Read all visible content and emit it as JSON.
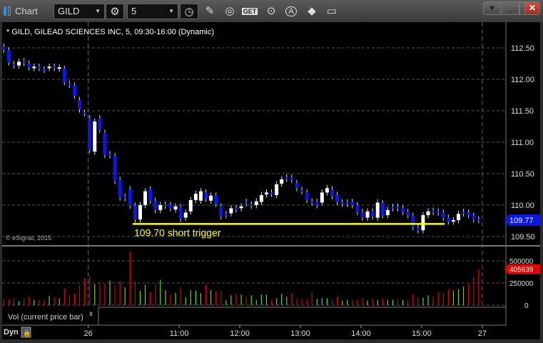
{
  "window": {
    "title": "Chart",
    "symbol": "GILD",
    "interval": "5",
    "tool_icons": [
      "pencil-icon",
      "chart-curve-icon",
      "get-icon",
      "play-icon",
      "alert-a-icon",
      "link-diamond-icon",
      "comment-icon"
    ],
    "get_label": "GET",
    "alert_label": "A"
  },
  "chart_title": "* GILD, GILEAD SCIENCES INC, 5, 09:30-16:00 (Dynamic)",
  "copyright": "© eSignal, 2015",
  "annotation": {
    "label": "109.70 short trigger",
    "price": 109.7,
    "color": "#ffff00"
  },
  "price_axis": {
    "labels": [
      "112.50",
      "112.00",
      "111.50",
      "111.00",
      "110.50",
      "110.00",
      "109.50"
    ],
    "values": [
      112.5,
      112,
      111.5,
      111,
      110.5,
      110,
      109.5
    ],
    "last_price": "109.77",
    "last_color": "#0a18e0"
  },
  "volume_axis": {
    "labels": [
      "500000",
      "250000",
      "0"
    ],
    "values": [
      500000,
      250000,
      0
    ],
    "last_volume": "405639",
    "last_color": "#e00000"
  },
  "volume_study": {
    "label": "Vol (current price bar)",
    "close": "x"
  },
  "time_axis": {
    "mode": "Dyn",
    "labels": [
      "26",
      "11:00",
      "12:00",
      "13:00",
      "14:00",
      "15:00",
      "27"
    ],
    "bar_index": [
      17,
      35,
      47,
      59,
      71,
      83,
      95
    ]
  },
  "colors": {
    "down": "#0a18e0",
    "up": "#ffffff",
    "vol_up": "#5ed62a",
    "vol_down": "#e00000",
    "grid": "#555555"
  },
  "chart_data": {
    "type": "candlestick",
    "ylim": [
      109.3,
      112.9
    ],
    "bars_oc": [
      [
        112.52,
        112.47
      ],
      [
        112.46,
        112.27
      ],
      [
        112.24,
        112.22
      ],
      [
        112.22,
        112.28
      ],
      [
        112.29,
        112.26
      ],
      [
        112.25,
        112.19
      ],
      [
        112.18,
        112.2
      ],
      [
        112.2,
        112.18
      ],
      [
        112.16,
        112.15
      ],
      [
        112.18,
        112.2
      ],
      [
        112.2,
        112.18
      ],
      [
        112.17,
        112.19
      ],
      [
        112.17,
        111.96
      ],
      [
        111.93,
        111.91
      ],
      [
        111.9,
        111.74
      ],
      [
        111.67,
        111.52
      ],
      [
        111.47,
        111.46
      ],
      [
        111.38,
        110.88
      ],
      [
        110.85,
        111.33
      ],
      [
        111.38,
        111.2
      ],
      [
        111.15,
        110.8
      ],
      [
        110.81,
        110.79
      ],
      [
        110.78,
        110.38
      ],
      [
        110.4,
        110.12
      ],
      [
        110.13,
        110.11
      ],
      [
        110.25,
        109.99
      ],
      [
        109.99,
        109.77
      ],
      [
        109.77,
        110.0
      ],
      [
        110.0,
        110.22
      ],
      [
        110.25,
        110.07
      ],
      [
        110.07,
        109.92
      ],
      [
        109.92,
        110.0
      ],
      [
        110.01,
        109.99
      ],
      [
        110.0,
        109.95
      ],
      [
        109.93,
        109.98
      ],
      [
        109.97,
        109.78
      ],
      [
        109.8,
        109.88
      ],
      [
        109.9,
        110.08
      ],
      [
        110.08,
        110.18
      ],
      [
        110.07,
        110.22
      ],
      [
        110.2,
        110.1
      ],
      [
        110.07,
        110.15
      ],
      [
        110.15,
        110.02
      ],
      [
        109.98,
        109.82
      ],
      [
        109.86,
        109.84
      ],
      [
        109.87,
        109.95
      ],
      [
        109.95,
        109.93
      ],
      [
        109.95,
        109.98
      ],
      [
        110.05,
        110.03
      ],
      [
        110.01,
        109.99
      ],
      [
        110.0,
        110.06
      ],
      [
        110.05,
        110.16
      ],
      [
        110.17,
        110.2
      ],
      [
        110.2,
        110.18
      ],
      [
        110.16,
        110.33
      ],
      [
        110.34,
        110.41
      ],
      [
        110.44,
        110.42
      ],
      [
        110.43,
        110.4
      ],
      [
        110.35,
        110.27
      ],
      [
        110.24,
        110.22
      ],
      [
        110.2,
        110.08
      ],
      [
        110.06,
        110.04
      ],
      [
        110.05,
        110.0
      ],
      [
        110.04,
        110.2
      ],
      [
        110.2,
        110.27
      ],
      [
        110.25,
        110.14
      ],
      [
        110.16,
        110.05
      ],
      [
        110.04,
        110.02
      ],
      [
        110.04,
        110.02
      ],
      [
        110.05,
        110.0
      ],
      [
        110.0,
        109.89
      ],
      [
        109.89,
        109.8
      ],
      [
        109.8,
        109.9
      ],
      [
        109.9,
        109.82
      ],
      [
        109.8,
        110.04
      ],
      [
        110.03,
        109.84
      ],
      [
        109.84,
        109.92
      ],
      [
        109.97,
        109.95
      ],
      [
        109.97,
        109.95
      ],
      [
        109.95,
        109.89
      ],
      [
        109.89,
        109.84
      ],
      [
        109.83,
        109.65
      ],
      [
        109.64,
        109.6
      ],
      [
        109.6,
        109.84
      ],
      [
        109.84,
        109.9
      ],
      [
        109.91,
        109.89
      ],
      [
        109.9,
        109.88
      ],
      [
        109.88,
        109.8
      ],
      [
        109.8,
        109.74
      ],
      [
        109.74,
        109.76
      ],
      [
        109.76,
        109.86
      ],
      [
        109.89,
        109.87
      ],
      [
        109.88,
        109.84
      ],
      [
        109.83,
        109.77
      ],
      [
        109.77,
        109.76
      ]
    ],
    "wick_extra": 0.05,
    "volume_k": [
      69,
      61,
      78,
      44,
      69,
      94,
      61,
      61,
      53,
      103,
      89,
      78,
      186,
      111,
      128,
      228,
      303,
      328,
      236,
      261,
      236,
      278,
      228,
      270,
      203,
      603,
      270,
      161,
      228,
      144,
      236,
      286,
      169,
      119,
      136,
      194,
      86,
      169,
      161,
      136,
      228,
      169,
      153,
      161,
      53,
      111,
      128,
      119,
      94,
      111,
      61,
      119,
      119,
      53,
      78,
      128,
      94,
      136,
      69,
      69,
      69,
      144,
      69,
      78,
      78,
      61,
      94,
      53,
      61,
      61,
      61,
      78,
      53,
      69,
      61,
      69,
      61,
      61,
      69,
      61,
      61,
      119,
      86,
      86,
      111,
      94,
      144,
      136,
      178,
      161,
      178,
      211,
      236,
      319,
      406
    ],
    "volume_up": [
      0,
      0,
      0,
      1,
      0,
      0,
      1,
      0,
      0,
      1,
      0,
      1,
      0,
      0,
      0,
      0,
      0,
      0,
      1,
      0,
      0,
      1,
      0,
      0,
      1,
      0,
      0,
      1,
      1,
      0,
      0,
      1,
      1,
      0,
      1,
      0,
      1,
      1,
      1,
      1,
      0,
      1,
      0,
      0,
      1,
      1,
      0,
      1,
      0,
      1,
      1,
      1,
      1,
      0,
      1,
      1,
      1,
      0,
      0,
      0,
      0,
      0,
      1,
      1,
      1,
      0,
      0,
      1,
      1,
      0,
      0,
      0,
      1,
      0,
      1,
      0,
      1,
      1,
      0,
      1,
      0,
      0,
      0,
      1,
      1,
      0,
      0,
      0,
      0,
      1,
      1,
      1,
      0,
      0,
      0
    ]
  }
}
